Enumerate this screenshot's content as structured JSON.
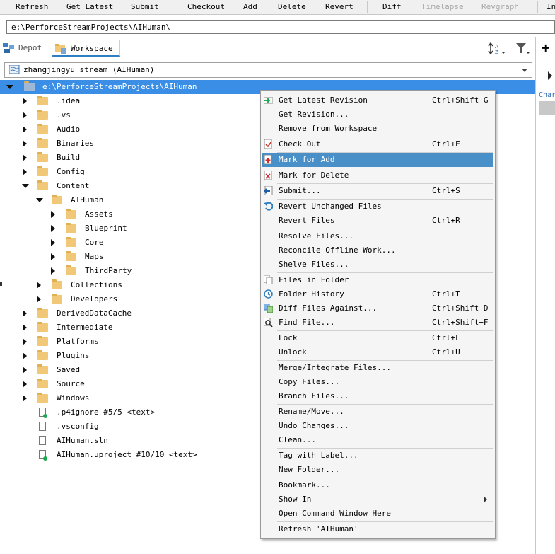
{
  "toolbar": {
    "buttons": [
      {
        "label": "Refresh",
        "enabled": true
      },
      {
        "label": "Get Latest",
        "enabled": true
      },
      {
        "label": "Submit",
        "enabled": true
      },
      {
        "label": "Checkout",
        "enabled": true
      },
      {
        "label": "Add",
        "enabled": true
      },
      {
        "label": "Delete",
        "enabled": true
      },
      {
        "label": "Revert",
        "enabled": true
      },
      {
        "label": "Diff",
        "enabled": true
      },
      {
        "label": "Timelapse",
        "enabled": false
      },
      {
        "label": "Revgraph",
        "enabled": false
      },
      {
        "label": "In",
        "enabled": true
      }
    ]
  },
  "path_bar": {
    "value": "e:\\PerforceStreamProjects\\AIHuman\\"
  },
  "tabs": [
    {
      "label": "Depot",
      "active": false,
      "icon": "depot-icon"
    },
    {
      "label": "Workspace",
      "active": true,
      "icon": "workspace-icon"
    }
  ],
  "right_panel": {
    "add_label": "+",
    "column_label": "Char"
  },
  "stream": {
    "value": "zhangjingyu_stream (AIHuman)"
  },
  "tree": [
    {
      "label": "e:\\PerforceStreamProjects\\AIHuman",
      "type": "folder",
      "depth": 0,
      "expanded": true,
      "selected": true
    },
    {
      "label": ".idea",
      "type": "folder",
      "depth": 1,
      "expanded": false
    },
    {
      "label": ".vs",
      "type": "folder",
      "depth": 1,
      "expanded": false
    },
    {
      "label": "Audio",
      "type": "folder",
      "depth": 1,
      "expanded": false
    },
    {
      "label": "Binaries",
      "type": "folder",
      "depth": 1,
      "expanded": false
    },
    {
      "label": "Build",
      "type": "folder",
      "depth": 1,
      "expanded": false
    },
    {
      "label": "Config",
      "type": "folder",
      "depth": 1,
      "expanded": false
    },
    {
      "label": "Content",
      "type": "folder",
      "depth": 1,
      "expanded": true
    },
    {
      "label": "AIHuman",
      "type": "folder",
      "depth": 2,
      "expanded": true
    },
    {
      "label": "Assets",
      "type": "folder",
      "depth": 3,
      "expanded": false
    },
    {
      "label": "Blueprint",
      "type": "folder",
      "depth": 3,
      "expanded": false
    },
    {
      "label": "Core",
      "type": "folder",
      "depth": 3,
      "expanded": false
    },
    {
      "label": "Maps",
      "type": "folder",
      "depth": 3,
      "expanded": false
    },
    {
      "label": "ThirdParty",
      "type": "folder",
      "depth": 3,
      "expanded": false
    },
    {
      "label": "Collections",
      "type": "folder",
      "depth": 2,
      "expanded": false
    },
    {
      "label": "Developers",
      "type": "folder",
      "depth": 2,
      "expanded": false
    },
    {
      "label": "DerivedDataCache",
      "type": "folder",
      "depth": 1,
      "expanded": false
    },
    {
      "label": "Intermediate",
      "type": "folder",
      "depth": 1,
      "expanded": false
    },
    {
      "label": "Platforms",
      "type": "folder",
      "depth": 1,
      "expanded": false
    },
    {
      "label": "Plugins",
      "type": "folder",
      "depth": 1,
      "expanded": false
    },
    {
      "label": "Saved",
      "type": "folder",
      "depth": 1,
      "expanded": false
    },
    {
      "label": "Source",
      "type": "folder",
      "depth": 1,
      "expanded": false
    },
    {
      "label": "Windows",
      "type": "folder",
      "depth": 1,
      "expanded": false
    },
    {
      "label": ".p4ignore #5/5 <text>",
      "type": "file",
      "depth": 1,
      "green": true
    },
    {
      "label": ".vsconfig",
      "type": "file",
      "depth": 1,
      "green": false
    },
    {
      "label": "AIHuman.sln",
      "type": "file",
      "depth": 1,
      "green": false
    },
    {
      "label": "AIHuman.uproject #10/10 <text>",
      "type": "file",
      "depth": 1,
      "green": true
    }
  ],
  "context_menu": {
    "items": [
      {
        "label": "Get Latest Revision",
        "shortcut": "Ctrl+Shift+G",
        "icon": "get-latest-icon"
      },
      {
        "label": "Get Revision...",
        "shortcut": ""
      },
      {
        "label": "Remove from Workspace",
        "shortcut": ""
      },
      {
        "sep": true
      },
      {
        "label": "Check Out",
        "shortcut": "Ctrl+E",
        "icon": "checkout-icon"
      },
      {
        "sep": true
      },
      {
        "label": "Mark for Add",
        "shortcut": "",
        "icon": "mark-add-icon",
        "highlighted": true
      },
      {
        "sep": true
      },
      {
        "label": "Mark for Delete",
        "shortcut": "",
        "icon": "mark-delete-icon"
      },
      {
        "sep": true
      },
      {
        "label": "Submit...",
        "shortcut": "Ctrl+S",
        "icon": "submit-icon"
      },
      {
        "sep": true
      },
      {
        "label": "Revert Unchanged Files",
        "shortcut": "",
        "icon": "revert-icon"
      },
      {
        "label": "Revert Files",
        "shortcut": "Ctrl+R"
      },
      {
        "sep": true
      },
      {
        "label": "Resolve Files...",
        "shortcut": ""
      },
      {
        "label": "Reconcile Offline Work...",
        "shortcut": ""
      },
      {
        "label": "Shelve Files...",
        "shortcut": ""
      },
      {
        "sep": true
      },
      {
        "label": "Files in Folder",
        "shortcut": "",
        "icon": "files-icon"
      },
      {
        "label": "Folder History",
        "shortcut": "Ctrl+T",
        "icon": "history-icon"
      },
      {
        "label": "Diff Files Against...",
        "shortcut": "Ctrl+Shift+D",
        "icon": "diff-icon"
      },
      {
        "label": "Find File...",
        "shortcut": "Ctrl+Shift+F",
        "icon": "find-icon"
      },
      {
        "sep": true
      },
      {
        "label": "Lock",
        "shortcut": "Ctrl+L"
      },
      {
        "label": "Unlock",
        "shortcut": "Ctrl+U"
      },
      {
        "sep": true
      },
      {
        "label": "Merge/Integrate Files...",
        "shortcut": ""
      },
      {
        "label": "Copy Files...",
        "shortcut": ""
      },
      {
        "label": "Branch Files...",
        "shortcut": ""
      },
      {
        "sep": true
      },
      {
        "label": "Rename/Move...",
        "shortcut": ""
      },
      {
        "label": "Undo Changes...",
        "shortcut": ""
      },
      {
        "label": "Clean...",
        "shortcut": ""
      },
      {
        "sep": true
      },
      {
        "label": "Tag with Label...",
        "shortcut": ""
      },
      {
        "label": "New Folder...",
        "shortcut": ""
      },
      {
        "sep": true
      },
      {
        "label": "Bookmark...",
        "shortcut": ""
      },
      {
        "label": "Show In",
        "shortcut": "",
        "submenu": true
      },
      {
        "label": "Open Command Window Here",
        "shortcut": ""
      },
      {
        "sep": true
      },
      {
        "label": "Refresh 'AIHuman'",
        "shortcut": ""
      }
    ]
  },
  "colors": {
    "selection": "#3a8ee6",
    "menu_highlight": "#4a90c8",
    "folder": "#f0c877",
    "accent": "#2d7fc1"
  }
}
